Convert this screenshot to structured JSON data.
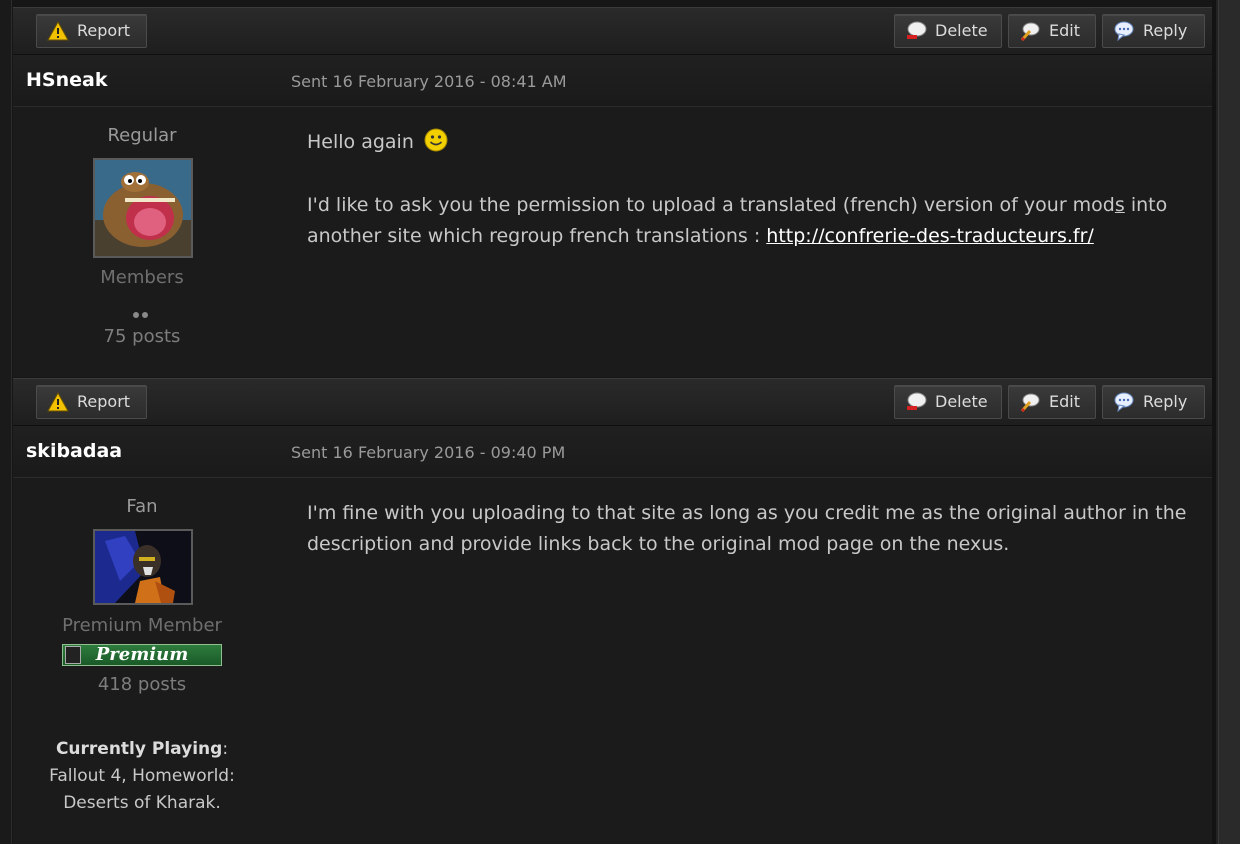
{
  "actions": {
    "report": "Report",
    "delete": "Delete",
    "edit": "Edit",
    "reply": "Reply"
  },
  "posts": [
    {
      "username": "HSneak",
      "sent": "Sent 16 February 2016 - 08:41 AM",
      "rank": "Regular",
      "group": "Members",
      "post_count": "75 posts",
      "message_line1": "Hello again",
      "message_p2_before": "I'd like to ask you the permission to upload a translated (french) version of your mod",
      "message_p2_underlined": "s",
      "message_p2_after": " into another site which regroup french translations : ",
      "link": "http://confrerie-des-traducteurs.fr/"
    },
    {
      "username": "skibadaa",
      "sent": "Sent 16 February 2016 - 09:40 PM",
      "rank": "Fan",
      "group": "Premium Member",
      "badge": "Premium",
      "post_count": "418 posts",
      "playing_label": "Currently Playing",
      "playing_value": "Fallout 4, Homeworld: Deserts of Kharak.",
      "message": "I'm fine with you uploading to that site as long as you credit me as the original author in the description and provide links back to the original mod page on the nexus."
    }
  ]
}
